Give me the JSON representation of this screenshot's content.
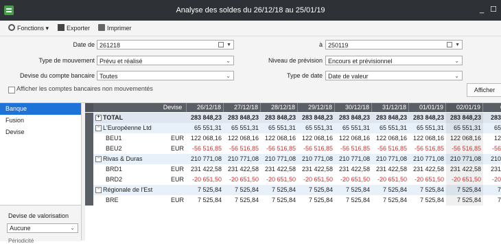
{
  "window": {
    "title": "Analyse des soldes du 26/12/18 au 25/01/19",
    "minimize": "_",
    "maximize": "☐"
  },
  "toolbar": {
    "fonctions": "Fonctions ▾",
    "exporter": "Exporter",
    "imprimer": "Imprimer"
  },
  "form": {
    "date_de_label": "Date de",
    "date_de_value": "261218",
    "a_label": "à",
    "a_value": "250119",
    "type_mouvement_label": "Type de mouvement",
    "type_mouvement_value": "Prévu et réalisé",
    "niveau_prevision_label": "Niveau de prévision",
    "niveau_prevision_value": "Encours et prévisionnel",
    "devise_compte_label": "Devise du compte bancaire",
    "devise_compte_value": "Toutes",
    "type_date_label": "Type de date",
    "type_date_value": "Date de valeur",
    "afficher_comptes_label": "Afficher les comptes bancaires non mouvementés",
    "afficher_button": "Afficher"
  },
  "sidebar": {
    "items": [
      {
        "label": "Banque"
      },
      {
        "label": "Fusion"
      },
      {
        "label": "Devise"
      }
    ],
    "valorisation_title": "Devise de valorisation",
    "valorisation_value": "Aucune",
    "more_label": "Périodicité"
  },
  "grid": {
    "devise_header": "Devise",
    "dates": [
      "26/12/18",
      "27/12/18",
      "28/12/18",
      "29/12/18",
      "30/12/18",
      "31/12/18",
      "01/01/19",
      "02/01/19",
      "03/01/"
    ],
    "rows": [
      {
        "kind": "total",
        "label": "TOTAL",
        "devise": "",
        "expander": "+",
        "values": [
          "283 848,23",
          "283 848,23",
          "283 848,23",
          "283 848,23",
          "283 848,23",
          "283 848,23",
          "283 848,23",
          "283 848,23",
          "283 848,2"
        ]
      },
      {
        "kind": "group",
        "label": "L'Européenne Ltd",
        "devise": "",
        "expander": "−",
        "values": [
          "65 551,31",
          "65 551,31",
          "65 551,31",
          "65 551,31",
          "65 551,31",
          "65 551,31",
          "65 551,31",
          "65 551,31",
          "65 551,3"
        ]
      },
      {
        "kind": "acct",
        "label": "BEU1",
        "devise": "EUR",
        "expander": "",
        "values": [
          "122 068,16",
          "122 068,16",
          "122 068,16",
          "122 068,16",
          "122 068,16",
          "122 068,16",
          "122 068,16",
          "122 068,16",
          "122 068,"
        ]
      },
      {
        "kind": "acct",
        "label": "BEU2",
        "devise": "EUR",
        "expander": "",
        "negative": true,
        "values": [
          "-56 516,85",
          "-56 516,85",
          "-56 516,85",
          "-56 516,85",
          "-56 516,85",
          "-56 516,85",
          "-56 516,85",
          "-56 516,85",
          "-56 516,8"
        ]
      },
      {
        "kind": "group",
        "label": "Rivas & Duras",
        "devise": "",
        "expander": "−",
        "values": [
          "210 771,08",
          "210 771,08",
          "210 771,08",
          "210 771,08",
          "210 771,08",
          "210 771,08",
          "210 771,08",
          "210 771,08",
          "210 771,0"
        ]
      },
      {
        "kind": "acct",
        "label": "BRD1",
        "devise": "EUR",
        "expander": "",
        "values": [
          "231 422,58",
          "231 422,58",
          "231 422,58",
          "231 422,58",
          "231 422,58",
          "231 422,58",
          "231 422,58",
          "231 422,58",
          "231 422,5"
        ]
      },
      {
        "kind": "acct",
        "label": "BRD2",
        "devise": "EUR",
        "expander": "",
        "negative": true,
        "values": [
          "-20 651,50",
          "-20 651,50",
          "-20 651,50",
          "-20 651,50",
          "-20 651,50",
          "-20 651,50",
          "-20 651,50",
          "-20 651,50",
          "-20 651,5"
        ]
      },
      {
        "kind": "group",
        "label": "Régionale de l'Est",
        "devise": "",
        "expander": "−",
        "values": [
          "7 525,84",
          "7 525,84",
          "7 525,84",
          "7 525,84",
          "7 525,84",
          "7 525,84",
          "7 525,84",
          "7 525,84",
          "7 525,8"
        ]
      },
      {
        "kind": "acct",
        "label": "BRE",
        "devise": "EUR",
        "expander": "",
        "values": [
          "7 525,84",
          "7 525,84",
          "7 525,84",
          "7 525,84",
          "7 525,84",
          "7 525,84",
          "7 525,84",
          "7 525,84",
          "7 525,8"
        ]
      }
    ]
  },
  "colors": {
    "accent": "#1e73d8",
    "negative": "#d03030",
    "titlebar": "#2e3236",
    "grid_header": "#5a5f66"
  }
}
